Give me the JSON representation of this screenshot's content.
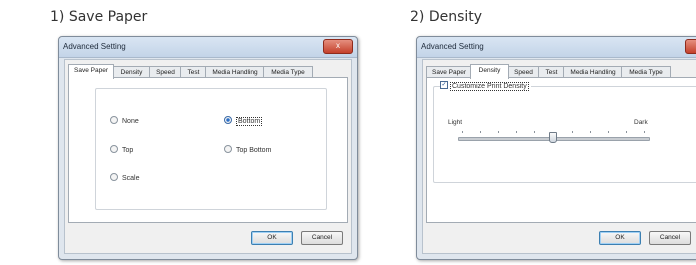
{
  "captions": {
    "left": "1) Save Paper",
    "right": "2) Density"
  },
  "dialog_left": {
    "title": "Advanced Setting",
    "close_label": "x",
    "tabs": [
      "Save Paper",
      "Density",
      "Speed",
      "Test",
      "Media Handling",
      "Media Type"
    ],
    "active_tab": "Save Paper",
    "options": [
      {
        "label": "None",
        "selected": false
      },
      {
        "label": "Bottom",
        "selected": true
      },
      {
        "label": "Top",
        "selected": false
      },
      {
        "label": "Top Bottom",
        "selected": false
      },
      {
        "label": "Scale",
        "selected": false
      }
    ],
    "ok_label": "OK",
    "cancel_label": "Cancel"
  },
  "dialog_right": {
    "title": "Advanced Setting",
    "tabs": [
      "Save Paper",
      "Density",
      "Speed",
      "Test",
      "Media Handling",
      "Media Type"
    ],
    "active_tab": "Density",
    "customize_label": "Customize Print Density",
    "customize_checked": true,
    "light_label": "Light",
    "dark_label": "Dark",
    "slider_value": 0.5,
    "ok_label": "OK",
    "cancel_label": "Cancel"
  },
  "colors": {
    "title_bar": "#c9d9ec",
    "close_button": "#c4402b",
    "dialog_bg": "#f0f0f0"
  }
}
